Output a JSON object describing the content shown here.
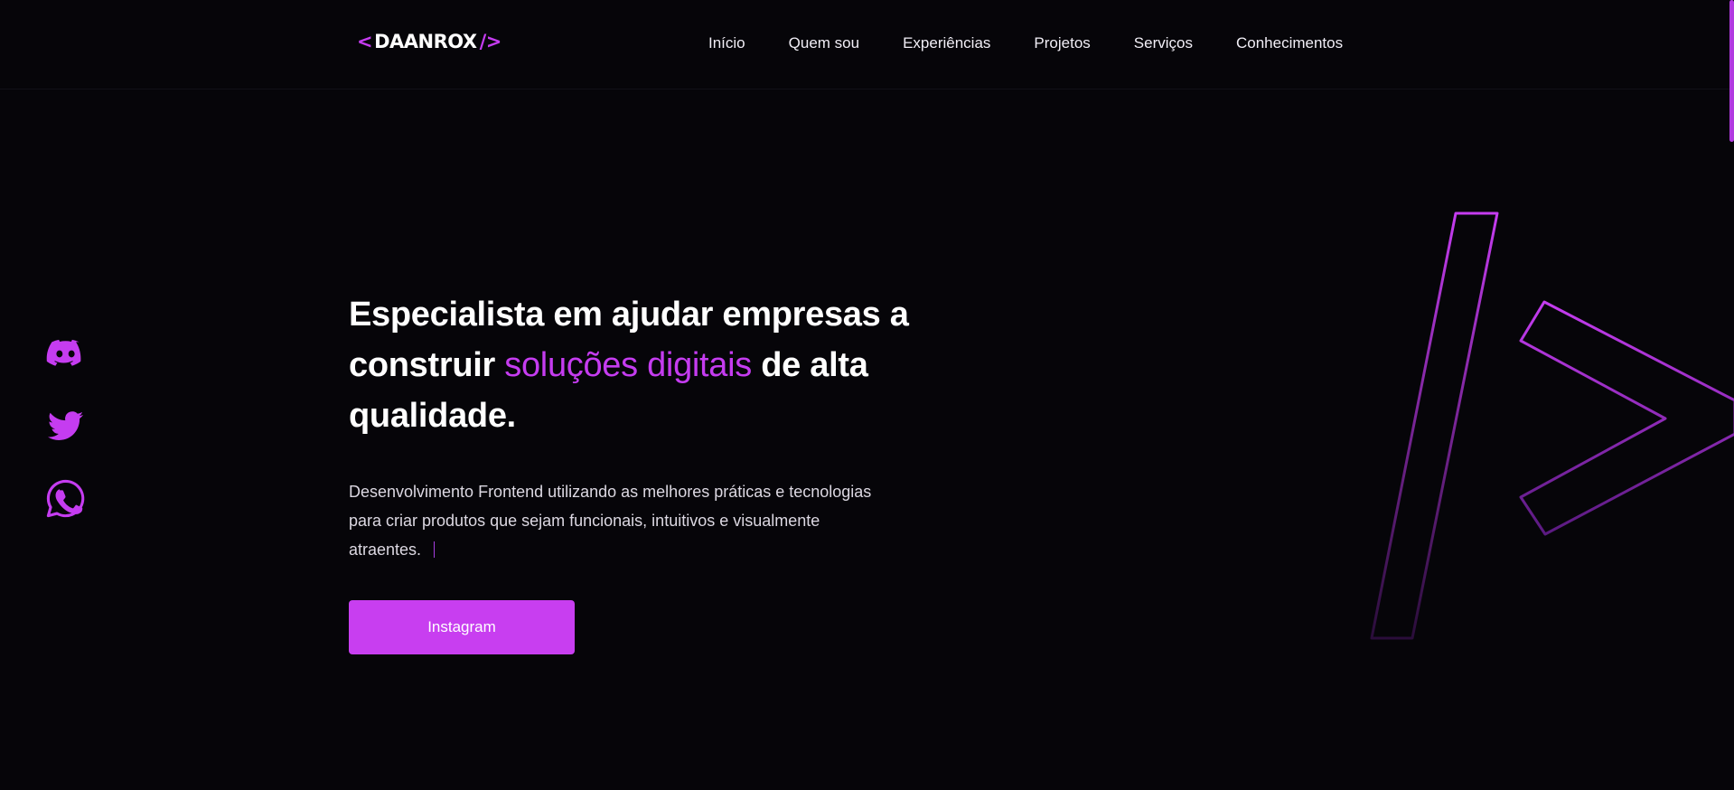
{
  "header": {
    "logo": {
      "open": "<",
      "name": "DAANROX",
      "close": "/>"
    },
    "nav": [
      "Início",
      "Quem sou",
      "Experiências",
      "Projetos",
      "Serviços",
      "Conhecimentos"
    ]
  },
  "social": {
    "icons": [
      "discord-icon",
      "twitter-icon",
      "whatsapp-icon"
    ]
  },
  "hero": {
    "title_before": "Especialista em ajudar empresas a construir",
    "title_accent": "soluções digitais",
    "title_after": "de alta qualidade.",
    "description": "Desenvolvimento Frontend utilizando as melhores práticas e tecnologias para criar produtos que sejam funcionais, intuitivos e visualmente atraentes.",
    "cta_label": "Instagram"
  },
  "colors": {
    "accent": "#c53cf0",
    "background": "#060509",
    "button": "#c83ef0"
  }
}
